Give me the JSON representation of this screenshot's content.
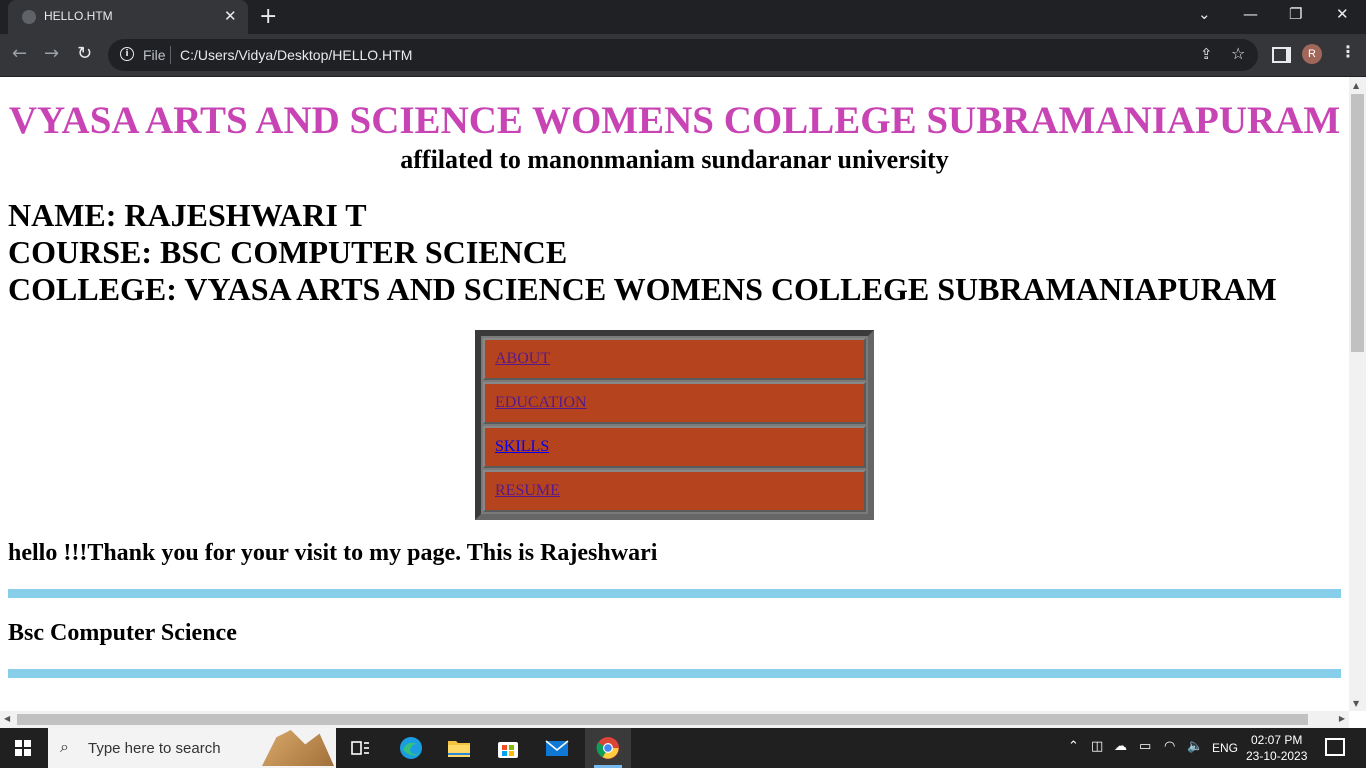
{
  "browser": {
    "tab_title": "HELLO.HTM",
    "tab_close": "✕",
    "new_tab": "+",
    "window_controls": {
      "dropdown": "⌄",
      "minimize": "—",
      "restore": "❐",
      "close": "✕"
    },
    "nav": {
      "back": "←",
      "forward": "→",
      "reload": "↻"
    },
    "address": {
      "scheme_label": "File",
      "url": "C:/Users/Vidya/Desktop/HELLO.HTM",
      "info_glyph": "i"
    },
    "share_icon": "⇪",
    "bookmark_icon": "☆",
    "profile_initial": "R",
    "menu_icon": "⋮"
  },
  "page": {
    "college_title": "VYASA ARTS AND SCIENCE WOMENS COLLEGE SUBRAMANIAPURAM",
    "affiliation": "affilated to manonmaniam sundaranar university",
    "name_line": "NAME: RAJESHWARI T",
    "course_line": "COURSE: BSC COMPUTER SCIENCE",
    "college_line": "COLLEGE: VYASA ARTS AND SCIENCE WOMENS COLLEGE SUBRAMANIAPURAM",
    "nav_links": [
      "ABOUT",
      "EDUCATION",
      "SKILLS",
      "RESUME"
    ],
    "greeting": "hello !!!Thank you for your visit to my page. This is Rajeshwari",
    "course_heading": "Bsc Computer Science",
    "colors": {
      "title": "#c844b4",
      "nav_cell": "#b5441e",
      "rule": "#87ceeb",
      "visited_link": "#551a8b",
      "link": "#0000ee"
    }
  },
  "taskbar": {
    "search_placeholder": "Type here to search",
    "language": "ENG",
    "time": "02:07 PM",
    "date": "23-10-2023",
    "tray_icons": [
      "chevron-up-icon",
      "meet-now-icon",
      "onedrive-icon",
      "battery-icon",
      "wifi-icon",
      "volume-icon"
    ],
    "pinned_apps": [
      "task-view-icon",
      "edge-icon",
      "file-explorer-icon",
      "store-icon",
      "mail-icon",
      "chrome-icon"
    ]
  }
}
